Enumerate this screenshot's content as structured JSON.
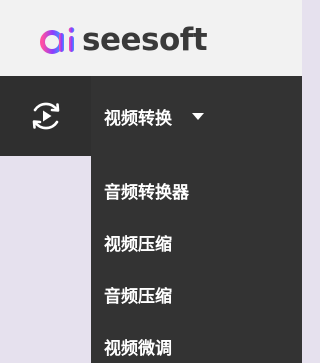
{
  "brand": {
    "logo_prefix": "ai",
    "logo_suffix": "seesoft",
    "gradient_colors": [
      "#ff4fa3",
      "#8a3cff",
      "#3aa0ff"
    ]
  },
  "nav": {
    "icon": "refresh-play-icon",
    "menu_label": "视频转换"
  },
  "dropdown": {
    "items": [
      {
        "label": "音频转换器"
      },
      {
        "label": "视频压缩"
      },
      {
        "label": "音频压缩"
      },
      {
        "label": "视频微调"
      }
    ]
  },
  "colors": {
    "header_bg": "#f2f2f2",
    "nav_bg": "#333333",
    "page_bg": "#e6e1ee",
    "text_light": "#ffffff"
  }
}
